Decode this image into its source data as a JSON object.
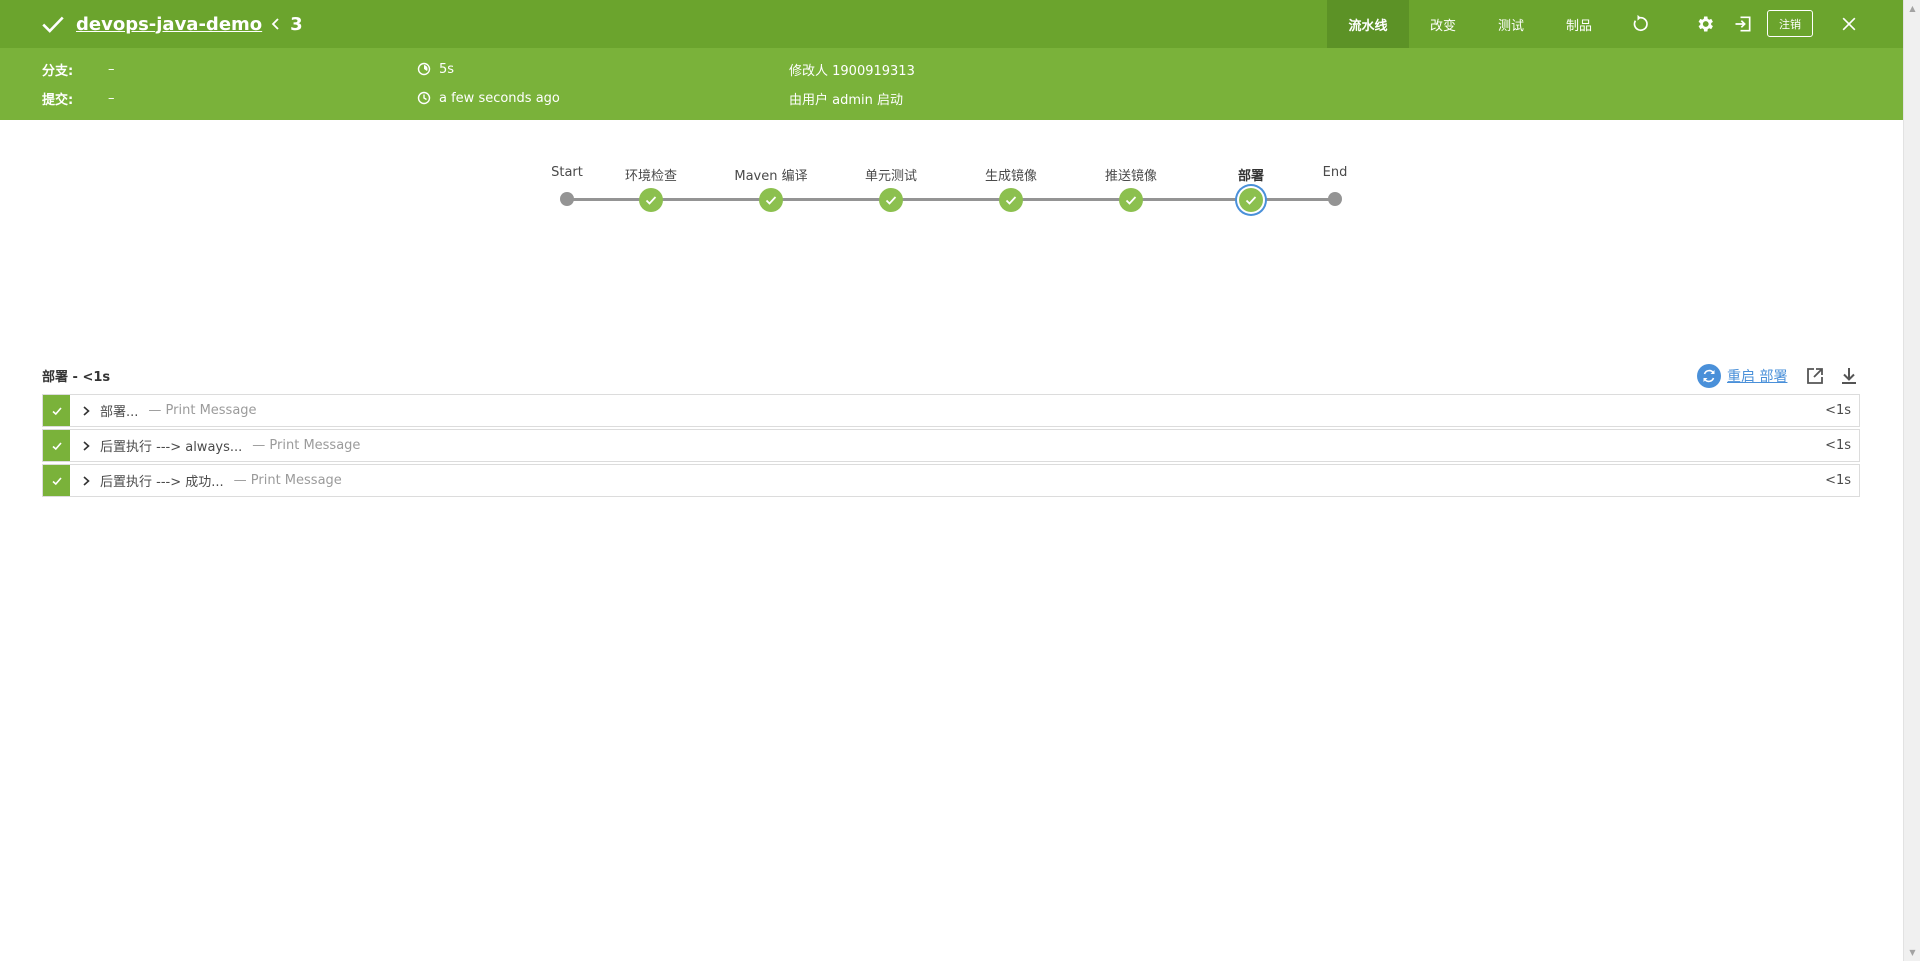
{
  "header": {
    "project_title": "devops-java-demo",
    "run_number": "3",
    "tabs": [
      {
        "label": "流水线",
        "active": true
      },
      {
        "label": "改变",
        "active": false
      },
      {
        "label": "测试",
        "active": false
      },
      {
        "label": "制品",
        "active": false
      }
    ],
    "logout_label": "注销",
    "bg_color": "#6ba42d"
  },
  "meta": {
    "branch_label": "分支:",
    "branch_value": "–",
    "commit_label": "提交:",
    "commit_value": "–",
    "duration": "5s",
    "started": "a few seconds ago",
    "modified_by": "修改人 1900919313",
    "started_by": "由用户 admin 启动"
  },
  "pipeline": {
    "stages": [
      {
        "label": "Start",
        "status": "start"
      },
      {
        "label": "环境检查",
        "status": "success"
      },
      {
        "label": "Maven 编译",
        "status": "success"
      },
      {
        "label": "单元测试",
        "status": "success"
      },
      {
        "label": "生成镜像",
        "status": "success"
      },
      {
        "label": "推送镜像",
        "status": "success"
      },
      {
        "label": "部署",
        "status": "success",
        "selected": true
      },
      {
        "label": "End",
        "status": "end"
      }
    ]
  },
  "stage_detail": {
    "title": "部署 - <1s",
    "restart_label": "重启 部署",
    "steps": [
      {
        "name": "部署...",
        "desc": "— Print Message",
        "duration": "<1s"
      },
      {
        "name": "后置执行 ---> always...",
        "desc": "— Print Message",
        "duration": "<1s"
      },
      {
        "name": "后置执行 ---> 成功...",
        "desc": "— Print Message",
        "duration": "<1s"
      }
    ]
  },
  "colors": {
    "success": "#8cc04f",
    "header_green": "#6ba42d",
    "subheader_green": "#7ab23a",
    "link_blue": "#4a90d9"
  }
}
